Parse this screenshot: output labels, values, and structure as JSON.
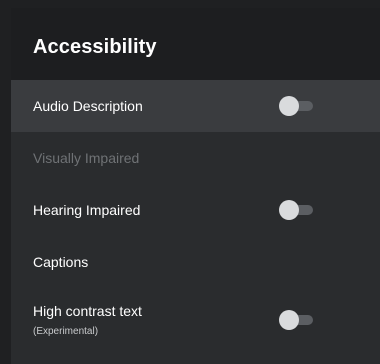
{
  "header": {
    "title": "Accessibility"
  },
  "items": [
    {
      "label": "Audio Description",
      "toggle": "off"
    },
    {
      "label": "Visually Impaired"
    },
    {
      "label": "Hearing Impaired",
      "toggle": "off"
    },
    {
      "label": "Captions"
    },
    {
      "label": "High contrast text",
      "sublabel": "(Experimental)",
      "toggle": "off"
    }
  ],
  "colors": {
    "background": "#1f2022",
    "panel": "#2a2c2e",
    "header": "#1d1e20",
    "focused_row": "#3a3c3f",
    "text": "#ffffff",
    "disabled_text": "#6f7275",
    "toggle_knob": "#d9dbdd",
    "toggle_track": "#5b5e62"
  }
}
